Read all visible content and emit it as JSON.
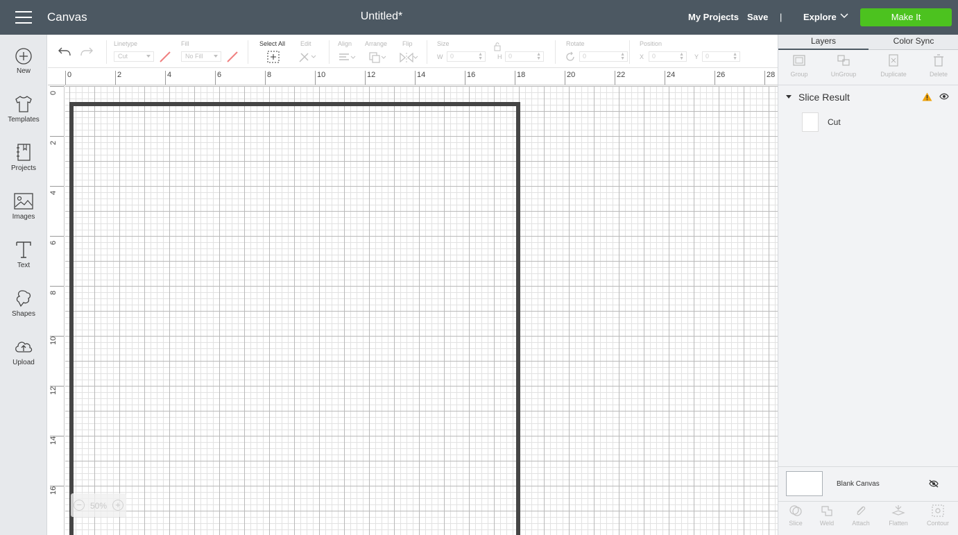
{
  "header": {
    "app_title": "Canvas",
    "doc_title": "Untitled*",
    "my_projects": "My Projects",
    "save": "Save",
    "divider": "|",
    "explore": "Explore",
    "make_it": "Make It",
    "bg_color": "#4c5862",
    "accent_color": "#4cc21f"
  },
  "sidebar": {
    "items": [
      {
        "label": "New",
        "icon": "plus-circle-icon"
      },
      {
        "label": "Templates",
        "icon": "tshirt-icon"
      },
      {
        "label": "Projects",
        "icon": "notebook-icon"
      },
      {
        "label": "Images",
        "icon": "image-icon"
      },
      {
        "label": "Text",
        "icon": "text-t-icon"
      },
      {
        "label": "Shapes",
        "icon": "shapes-icon"
      },
      {
        "label": "Upload",
        "icon": "cloud-upload-icon"
      }
    ]
  },
  "toolbar": {
    "linetype_label": "Linetype",
    "linetype_value": "Cut",
    "fill_label": "Fill",
    "fill_value": "No Fill",
    "select_all_label": "Select All",
    "edit_label": "Edit",
    "align_label": "Align",
    "arrange_label": "Arrange",
    "flip_label": "Flip",
    "size_label": "Size",
    "width_axis": "W",
    "width_value": "0",
    "height_axis": "H",
    "height_value": "0",
    "rotate_label": "Rotate",
    "rotate_value": "0",
    "position_label": "Position",
    "x_axis": "X",
    "x_value": "0",
    "y_axis": "Y",
    "y_value": "0"
  },
  "canvas": {
    "ruler_top": [
      "0",
      "2",
      "4",
      "6",
      "8",
      "10",
      "12",
      "14",
      "16",
      "18",
      "20",
      "22",
      "24",
      "26",
      "28"
    ],
    "ruler_left": [
      "0",
      "2",
      "4",
      "6",
      "8",
      "10",
      "12",
      "14",
      "16"
    ],
    "zoom_minus": "−",
    "zoom_level": "50%",
    "zoom_plus": "+"
  },
  "panel": {
    "tabs": [
      "Layers",
      "Color Sync"
    ],
    "actions": [
      "Group",
      "UnGroup",
      "Duplicate",
      "Delete"
    ],
    "group_name": "Slice Result",
    "layer_name": "Cut",
    "blank_canvas_label": "Blank Canvas",
    "bottom_actions": [
      "Slice",
      "Weld",
      "Attach",
      "Flatten",
      "Contour"
    ],
    "warning_color": "#f0a30a"
  }
}
